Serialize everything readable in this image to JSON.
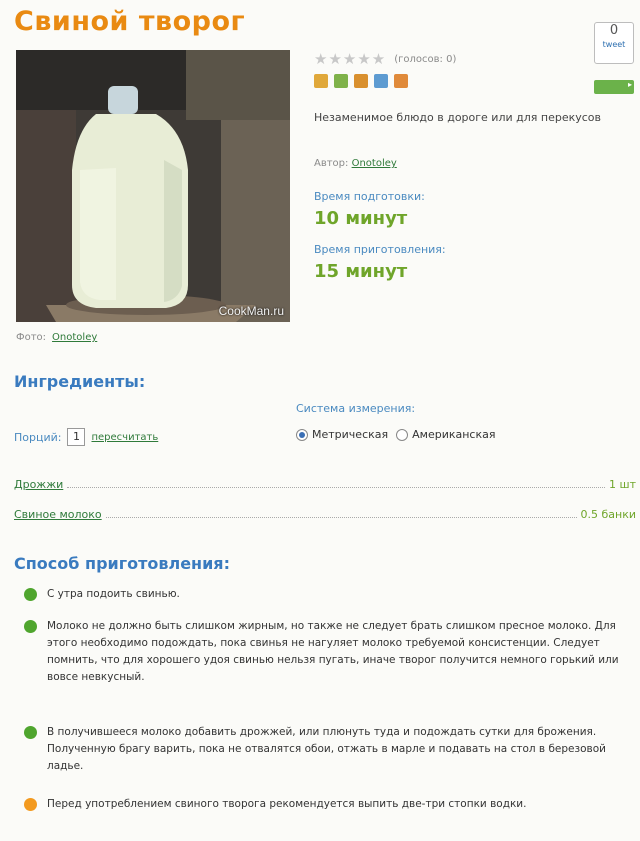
{
  "title": "Свиной творог",
  "rating": {
    "stars": "★★★★★",
    "votes": "(голосов: 0)"
  },
  "description": "Незаменимое блюдо в дороге или для перекусов",
  "author": {
    "label": "Автор:",
    "name": "Onotoley"
  },
  "prep": {
    "label": "Время подготовки:",
    "value": "10 минут"
  },
  "cook": {
    "label": "Время приготовления:",
    "value": "15 минут"
  },
  "photo": {
    "watermark": "CookMan.ru",
    "credit_label": "Фото:",
    "credit_name": "Onotoley"
  },
  "share": {
    "count": "0",
    "tweet": "tweet"
  },
  "ingredients": {
    "heading": "Ингредиенты:",
    "measure_label": "Система измерения:",
    "portions_label": "Порций:",
    "portions_value": "1",
    "recalc": "пересчитать",
    "metric": "Метрическая",
    "american": "Американская",
    "items": [
      {
        "name": "Дрожжи",
        "qty": "1 шт"
      },
      {
        "name": "Свиное молоко",
        "qty": "0.5 банки"
      }
    ]
  },
  "method": {
    "heading": "Способ приготовления:",
    "steps": [
      "С утра подоить свинью.",
      "Молоко не должно быть слишком жирным, но также не следует брать слишком пресное молоко. Для этого необходимо подождать, пока свинья не нагуляет молоко требуемой консистенции. Следует помнить, что для хорошего удоя свинью нельзя пугать, иначе творог получится немного горький или вовсе невкусный.",
      "В получившееся молоко добавить дрожжей, или плюнуть туда и подождать сутки для брожения. Полученную брагу варить, пока не отвалятся обои, отжать в марле и подавать на стол в березовой ладье.",
      "Перед употреблением свиного творога рекомендуется выпить две-три стопки водки."
    ]
  },
  "colors": {
    "title": "#e98a12",
    "heading": "#3a7bbf",
    "value": "#6fa52a",
    "link": "#2f7a3a"
  }
}
